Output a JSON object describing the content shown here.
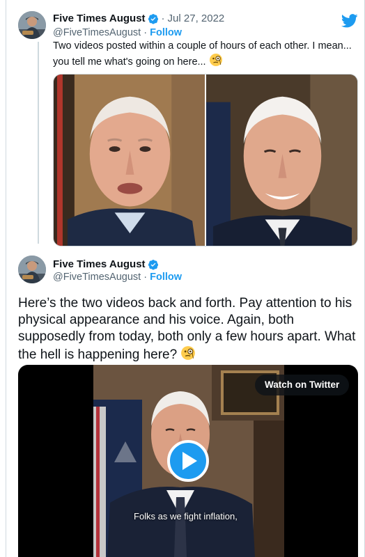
{
  "tweet1": {
    "name": "Five Times August",
    "date": "Jul 27, 2022",
    "separator": "·",
    "handle": "@FiveTimesAugust",
    "follow_label": "Follow",
    "text": "Two videos posted within a couple of hours of each other. I mean... you tell me what's going on here...",
    "emoji": "monocle-face-icon",
    "photos": [
      "left-photo",
      "right-photo"
    ]
  },
  "tweet2": {
    "name": "Five Times August",
    "handle": "@FiveTimesAugust",
    "separator": "·",
    "follow_label": "Follow",
    "text": "Here’s the two videos back and forth.  Pay attention to his physical appearance and his voice. Again, both supposedly from today,  both only a few hours apart. What the hell is happening here?",
    "emoji": "monocle-face-icon"
  },
  "video": {
    "watch_label": "Watch on Twitter",
    "subtitle": "Folks as we fight inflation,"
  },
  "colors": {
    "accent": "#1d9bf0",
    "text": "#0f1419",
    "muted": "#536471",
    "border": "#cfd9de"
  }
}
